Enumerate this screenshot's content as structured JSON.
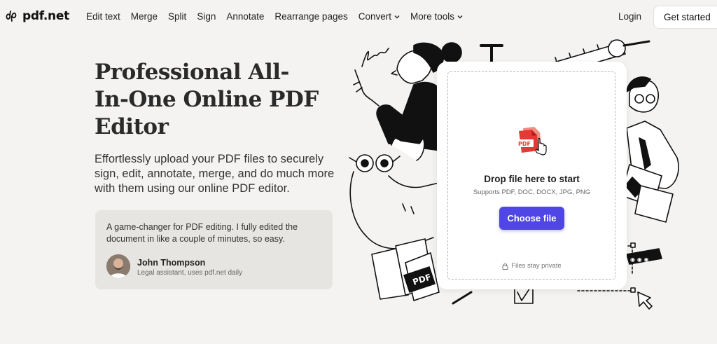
{
  "brand": {
    "name": "pdf.net"
  },
  "nav": {
    "items": [
      {
        "label": "Edit text"
      },
      {
        "label": "Merge"
      },
      {
        "label": "Split"
      },
      {
        "label": "Sign"
      },
      {
        "label": "Annotate"
      },
      {
        "label": "Rearrange pages"
      },
      {
        "label": "Convert",
        "dropdown": true
      },
      {
        "label": "More tools",
        "dropdown": true
      }
    ],
    "login": "Login",
    "get_started": "Get started"
  },
  "hero": {
    "title": "Professional All-In-One Online PDF Editor",
    "subtitle": "Effortlessly upload your PDF files to securely sign, edit, annotate, merge, and do much more with them using our online PDF editor."
  },
  "testimonial": {
    "quote": "A game-changer for PDF editing. I fully edited the document in like a couple of minutes, so easy.",
    "author": "John Thompson",
    "role": "Legal assistant, uses pdf.net daily"
  },
  "upload": {
    "icon_label": "PDF",
    "title": "Drop file here to start",
    "supports": "Supports PDF, DOC, DOCX, JPG, PNG",
    "button": "Choose file",
    "privacy": "Files stay private"
  },
  "illustration": {
    "pdf_label": "PDF",
    "t_letter": "T"
  },
  "colors": {
    "accent": "#4f46e5",
    "pdf_red": "#e53935",
    "background": "#f4f3f1"
  }
}
